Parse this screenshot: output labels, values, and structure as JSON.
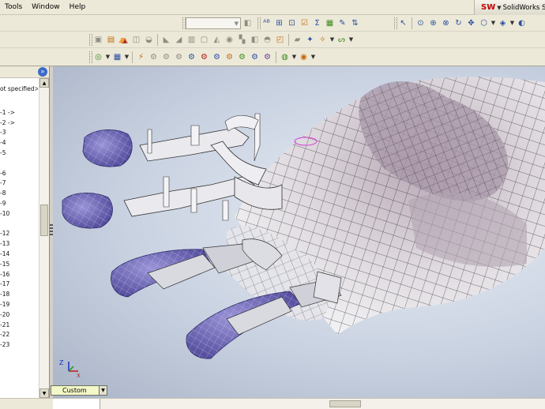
{
  "menu": [
    "Tools",
    "Window",
    "Help"
  ],
  "app_title": "SolidWorks Se",
  "app_logo": "SW",
  "feature_tree": {
    "header_item": "ot specified>",
    "items": [
      "",
      "-1 ->",
      "-2 ->",
      "-3",
      "-4",
      "-5",
      "",
      "-6",
      "-7",
      "-8",
      "-9",
      "-10",
      "",
      "-12",
      "-13",
      "-14",
      "-15",
      "-16",
      "-17",
      "-18",
      "-19",
      "-20",
      "-21",
      "-22",
      "-23"
    ]
  },
  "view_orientation": {
    "selected": "Custom"
  },
  "colors": {
    "toolbar_bg": "#ece9d8",
    "viewport_top": "#e9eef6",
    "viewport_edge": "#a9b4c7",
    "fingertip": "#6a62b8"
  },
  "icons": {
    "row1": [
      "sketch-dropdown",
      "rebuild-icon",
      "spell-check-icon",
      "hierarchy-icon",
      "measure-icon",
      "check-icon",
      "sum-icon",
      "colors-icon",
      "tools-icon",
      "smart-icon",
      "pointer-icon",
      "zoom-fit-icon",
      "zoom-area-icon",
      "zoom-in-icon",
      "rotate-icon",
      "pan-icon",
      "view-orientation-icon",
      "display-style-icon"
    ],
    "row2": [
      "edit-icon",
      "extrude-icon",
      "revolve-icon",
      "loft-icon",
      "sweep-icon",
      "fillet-icon",
      "chamfer-icon",
      "rib-icon",
      "shell-icon",
      "draft-icon",
      "hole-icon",
      "pattern-icon",
      "mirror-icon",
      "dome-icon",
      "reference-icon",
      "curve-icon"
    ],
    "row3": [
      "assembly-icon",
      "mate-icon",
      "move-component-icon",
      "rotate-component-icon",
      "smart-fastener-icon",
      "explode-icon",
      "interference-icon",
      "hide-icon",
      "show-icon",
      "transparency-icon",
      "section-icon",
      "physical-dynamics-icon",
      "lighting-icon",
      "appearance-icon"
    ]
  }
}
